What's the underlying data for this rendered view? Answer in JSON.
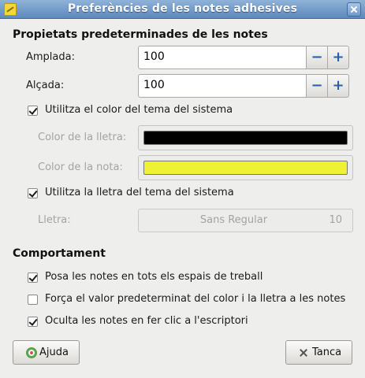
{
  "window": {
    "title": "Preferències de les notes adhesives"
  },
  "defaults": {
    "heading": "Propietats predeterminades de les notes",
    "width": {
      "label": "Amplada:",
      "value": "100"
    },
    "height": {
      "label": "Alçada:",
      "value": "100"
    },
    "use_theme_color": {
      "label": "Utilitza el color del tema del sistema",
      "checked": true
    },
    "text_color": {
      "label": "Color de la lletra:",
      "color": "#000000"
    },
    "note_color": {
      "label": "Color de la nota:",
      "color": "#eef232"
    },
    "use_theme_font": {
      "label": "Utilitza la lletra del tema del sistema",
      "checked": true
    },
    "font": {
      "label": "Lletra:",
      "name": "Sans Regular",
      "size": "10"
    }
  },
  "behavior": {
    "heading": "Comportament",
    "all_workspaces": {
      "label": "Posa les notes en tots els espais de treball",
      "checked": true
    },
    "force_default": {
      "label": "Força el valor predeterminat del color i la lletra a les notes",
      "checked": false
    },
    "hide_on_desktop_click": {
      "label": "Oculta les notes en fer clic a l'escriptori",
      "checked": true
    }
  },
  "buttons": {
    "help": "Ajuda",
    "close": "Tanca"
  },
  "icons": {
    "app": "sticky-note-icon",
    "help": "help-lifebuoy-icon",
    "close": "close-icon"
  }
}
